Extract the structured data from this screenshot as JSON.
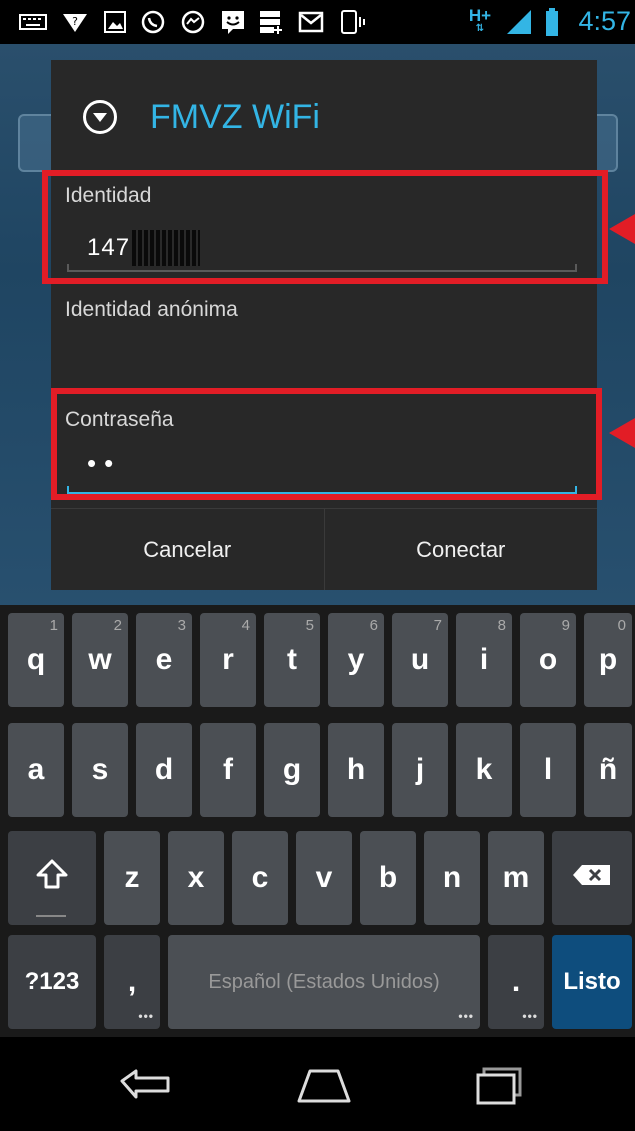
{
  "status_bar": {
    "time": "4:57",
    "network_label": "H+",
    "icons": [
      "keyboard-icon",
      "wifi-warning-icon",
      "image-icon",
      "whatsapp-icon",
      "messenger-icon",
      "bbm-icon",
      "storage-icon",
      "gmail-icon",
      "vibrate-icon",
      "network-hplus-icon",
      "signal-icon",
      "battery-icon"
    ]
  },
  "dialog": {
    "title": "FMVZ WiFi",
    "identity": {
      "label": "Identidad",
      "value": "147"
    },
    "anonymous_identity": {
      "label": "Identidad anónima",
      "value": ""
    },
    "password": {
      "label": "Contraseña",
      "value": "••"
    },
    "cancel_label": "Cancelar",
    "connect_label": "Conectar"
  },
  "keyboard": {
    "row1": [
      {
        "key": "q",
        "hint": "1"
      },
      {
        "key": "w",
        "hint": "2"
      },
      {
        "key": "e",
        "hint": "3"
      },
      {
        "key": "r",
        "hint": "4"
      },
      {
        "key": "t",
        "hint": "5"
      },
      {
        "key": "y",
        "hint": "6"
      },
      {
        "key": "u",
        "hint": "7"
      },
      {
        "key": "i",
        "hint": "8"
      },
      {
        "key": "o",
        "hint": "9"
      },
      {
        "key": "p",
        "hint": "0"
      }
    ],
    "row2": [
      "a",
      "s",
      "d",
      "f",
      "g",
      "h",
      "j",
      "k",
      "l",
      "ñ"
    ],
    "row3": [
      "z",
      "x",
      "c",
      "v",
      "b",
      "n",
      "m"
    ],
    "symbols_label": "?123",
    "comma_label": ",",
    "space_label": "Español (Estados Unidos)",
    "period_label": ".",
    "done_label": "Listo"
  },
  "colors": {
    "accent": "#33b5e5",
    "highlight": "#e21d26",
    "dialog_bg": "#282828",
    "key_bg": "#4b4f54"
  }
}
